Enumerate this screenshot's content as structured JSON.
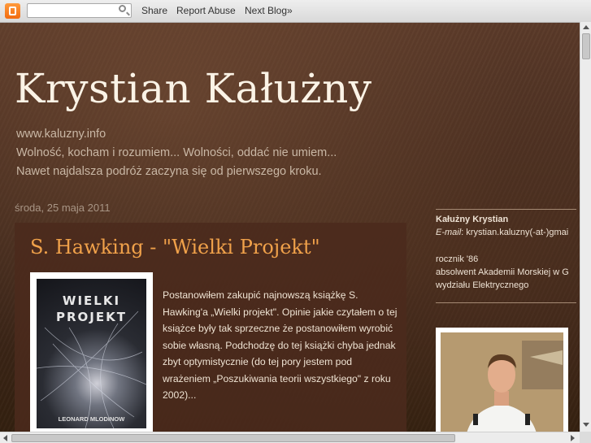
{
  "navbar": {
    "share_label": "Share",
    "report_label": "Report Abuse",
    "next_label": "Next Blog»",
    "search_value": ""
  },
  "header": {
    "title": "Krystian Kałużny",
    "url": "www.kaluzny.info",
    "motto1": "Wolność, kocham i rozumiem... Wolności, oddać nie umiem...",
    "motto2": "Nawet najdalsza podróż zaczyna się od pierwszego kroku."
  },
  "post": {
    "date": "środa, 25 maja 2011",
    "title": "S. Hawking - \"Wielki Projekt\"",
    "book_title1": "WIELKI",
    "book_title2": "PROJEKT",
    "book_author": "LEONARD MLODINOW",
    "body": "Postanowiłem zakupić najnowszą książkę S. Hawking'a „Wielki projekt\". Opinie jakie czytałem o tej książce były tak sprzeczne że postanowiłem wyrobić sobie własną. Podchodzę do tej książki chyba jednak  zbyt optymistycznie (do tej pory jestem pod wrażeniem „Poszukiwania teorii wszystkiego\" z roku 2002)..."
  },
  "sidebar": {
    "name": "Kałużny Krystian",
    "email_label": "E-mail",
    "email_value": ": krystian.kaluzny(-at-)gmai",
    "born": "rocznik '86",
    "edu1": "absolwent Akademii Morskiej w G",
    "edu2": "wydziału Elektrycznego"
  },
  "colors": {
    "post_title": "#f0a14a",
    "background": "#4a2f21"
  }
}
